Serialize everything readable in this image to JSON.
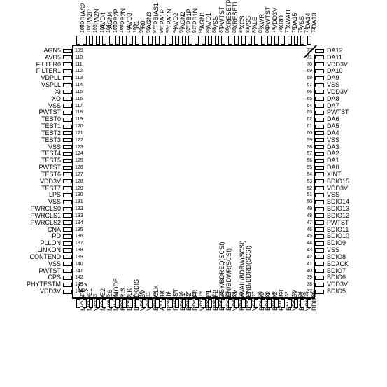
{
  "diagram": {
    "type": "ic-pinout",
    "package": "144-pin QFP",
    "pin_count": 144,
    "pin1_marker": "circle-top-left"
  },
  "pins": {
    "left": [
      {
        "num": "109",
        "label": "AGN5"
      },
      {
        "num": "110",
        "label": "AVD5"
      },
      {
        "num": "111",
        "label": "FILTER0"
      },
      {
        "num": "112",
        "label": "FILTER1"
      },
      {
        "num": "113",
        "label": "VDPLL"
      },
      {
        "num": "114",
        "label": "VSPLL"
      },
      {
        "num": "115",
        "label": "XI"
      },
      {
        "num": "116",
        "label": "XO"
      },
      {
        "num": "117",
        "label": "VSS"
      },
      {
        "num": "118",
        "label": "PWTST"
      },
      {
        "num": "119",
        "label": "TEST0"
      },
      {
        "num": "120",
        "label": "TEST1"
      },
      {
        "num": "121",
        "label": "TEST2"
      },
      {
        "num": "122",
        "label": "TEST3"
      },
      {
        "num": "123",
        "label": "VSS"
      },
      {
        "num": "124",
        "label": "TEST4"
      },
      {
        "num": "125",
        "label": "TEST5"
      },
      {
        "num": "126",
        "label": "PWTST"
      },
      {
        "num": "127",
        "label": "TEST6"
      },
      {
        "num": "128",
        "label": "VDD3V"
      },
      {
        "num": "129",
        "label": "TEST7"
      },
      {
        "num": "130",
        "label": "LPS"
      },
      {
        "num": "131",
        "label": "VSS"
      },
      {
        "num": "132",
        "label": "PWRCLS0"
      },
      {
        "num": "133",
        "label": "PWRCLS1"
      },
      {
        "num": "134",
        "label": "PWRCLS2"
      },
      {
        "num": "135",
        "label": "CNA"
      },
      {
        "num": "136",
        "label": "PD"
      },
      {
        "num": "137",
        "label": "PLLON"
      },
      {
        "num": "138",
        "label": "LINKON"
      },
      {
        "num": "139",
        "label": "CONTEND"
      },
      {
        "num": "140",
        "label": "VSS"
      },
      {
        "num": "141",
        "label": "PWTST"
      },
      {
        "num": "142",
        "label": "CPS"
      },
      {
        "num": "143",
        "label": "PHYTESTM"
      },
      {
        "num": "144",
        "label": "VDD3V"
      }
    ],
    "right": [
      {
        "num": "72",
        "label": "DA12"
      },
      {
        "num": "71",
        "label": "DA11"
      },
      {
        "num": "70",
        "label": "VDD3V"
      },
      {
        "num": "69",
        "label": "DA10"
      },
      {
        "num": "68",
        "label": "DA9"
      },
      {
        "num": "67",
        "label": "VSS"
      },
      {
        "num": "66",
        "label": "VDD3V"
      },
      {
        "num": "65",
        "label": "DA8"
      },
      {
        "num": "64",
        "label": "DA7"
      },
      {
        "num": "63",
        "label": "PWTST"
      },
      {
        "num": "62",
        "label": "DA6"
      },
      {
        "num": "61",
        "label": "DA5"
      },
      {
        "num": "60",
        "label": "DA4"
      },
      {
        "num": "59",
        "label": "VSS"
      },
      {
        "num": "58",
        "label": "DA3"
      },
      {
        "num": "57",
        "label": "DA2"
      },
      {
        "num": "56",
        "label": "DA1"
      },
      {
        "num": "55",
        "label": "DA0"
      },
      {
        "num": "54",
        "label": "XINT"
      },
      {
        "num": "53",
        "label": "BDIO15"
      },
      {
        "num": "52",
        "label": "VDD3V"
      },
      {
        "num": "51",
        "label": "VSS"
      },
      {
        "num": "50",
        "label": "BDIO14"
      },
      {
        "num": "49",
        "label": "BDIO13"
      },
      {
        "num": "48",
        "label": "BDIO12"
      },
      {
        "num": "47",
        "label": "PWTST"
      },
      {
        "num": "46",
        "label": "BDIO11"
      },
      {
        "num": "45",
        "label": "BDIO10"
      },
      {
        "num": "44",
        "label": "BDIO9"
      },
      {
        "num": "43",
        "label": "VSS"
      },
      {
        "num": "42",
        "label": "BDIO8"
      },
      {
        "num": "41",
        "label": "BDACK"
      },
      {
        "num": "40",
        "label": "BDIO7"
      },
      {
        "num": "39",
        "label": "BDIO6"
      },
      {
        "num": "38",
        "label": "VDD3V"
      },
      {
        "num": "37",
        "label": "BDIO5"
      }
    ],
    "top": [
      {
        "num": "108",
        "label": "TPBIAS2"
      },
      {
        "num": "107",
        "label": "TPA2P"
      },
      {
        "num": "106",
        "label": "TPA2N"
      },
      {
        "num": "105",
        "label": "AVD4"
      },
      {
        "num": "104",
        "label": "AGN4"
      },
      {
        "num": "103",
        "label": "TPB2P"
      },
      {
        "num": "102",
        "label": "TPB2N"
      },
      {
        "num": "101",
        "label": "AVD3"
      },
      {
        "num": "100",
        "label": "R1"
      },
      {
        "num": "99",
        "label": "R0"
      },
      {
        "num": "98",
        "label": "AGN3"
      },
      {
        "num": "97",
        "label": "TPBIAS1"
      },
      {
        "num": "96",
        "label": "TPA1P"
      },
      {
        "num": "95",
        "label": "TPA1N"
      },
      {
        "num": "94",
        "label": "AVD2"
      },
      {
        "num": "93",
        "label": "AGN2"
      },
      {
        "num": "92",
        "label": "TPB1P"
      },
      {
        "num": "91",
        "label": "TPB1N"
      },
      {
        "num": "90",
        "label": "AGN1"
      },
      {
        "num": "89",
        "label": "AVD1"
      },
      {
        "num": "88",
        "label": "VSS"
      },
      {
        "num": "87",
        "label": "PWTST"
      },
      {
        "num": "86",
        "label": "XRESETP"
      },
      {
        "num": "85",
        "label": "XRESETL"
      },
      {
        "num": "84",
        "label": "XCS"
      },
      {
        "num": "83",
        "label": "VSS"
      },
      {
        "num": "82",
        "label": "ALE"
      },
      {
        "num": "81",
        "label": "XWR"
      },
      {
        "num": "80",
        "label": "PWTST"
      },
      {
        "num": "79",
        "label": "VDD3V"
      },
      {
        "num": "78",
        "label": "XRD"
      },
      {
        "num": "77",
        "label": "XWAIT"
      },
      {
        "num": "76",
        "label": "DA15"
      },
      {
        "num": "75",
        "label": "VSS"
      },
      {
        "num": "74",
        "label": "DA14"
      },
      {
        "num": "73",
        "label": "DA13"
      }
    ],
    "bottom": [
      {
        "num": "1",
        "label": "MODE0"
      },
      {
        "num": "2",
        "label": "MODE1"
      },
      {
        "num": "3",
        "label": "VSS"
      },
      {
        "num": "4",
        "label": "MODE2"
      },
      {
        "num": "5",
        "label": "M8M16"
      },
      {
        "num": "6",
        "label": "MUXMODE"
      },
      {
        "num": "7",
        "label": "BDTRIS"
      },
      {
        "num": "8",
        "label": "BDICLK"
      },
      {
        "num": "9",
        "label": "BDCLKDIS"
      },
      {
        "num": "10",
        "label": "VDD3V"
      },
      {
        "num": "11",
        "label": "VSS"
      },
      {
        "num": "12",
        "label": "BDOCLK"
      },
      {
        "num": "13",
        "label": "ATAOX"
      },
      {
        "num": "14",
        "label": "BDIF0"
      },
      {
        "num": "15",
        "label": "PWTST"
      },
      {
        "num": "16",
        "label": "BDIF1"
      },
      {
        "num": "17",
        "label": "BDIF2"
      },
      {
        "num": "18",
        "label": "BDOF0"
      },
      {
        "num": "19",
        "label": "VSS"
      },
      {
        "num": "20",
        "label": "BDOF1"
      },
      {
        "num": "21",
        "label": "BDOF2"
      },
      {
        "num": "22",
        "label": "BDBUSY/BDREQ(SCSI)"
      },
      {
        "num": "23",
        "label": "BDOEN/BDWR(SCSI)"
      },
      {
        "num": "24",
        "label": "VDD3V"
      },
      {
        "num": "25",
        "label": "BDOAVAIL/BDRW(SCSI)"
      },
      {
        "num": "26",
        "label": "BDOENB/BDRD(SCSI)"
      },
      {
        "num": "27",
        "label": "VSS"
      },
      {
        "num": "28",
        "label": "BDIO0"
      },
      {
        "num": "29",
        "label": "BDIO1"
      },
      {
        "num": "30",
        "label": "BDIO2"
      },
      {
        "num": "31",
        "label": "PWTST"
      },
      {
        "num": "32",
        "label": "EN",
        "overline": true
      },
      {
        "num": "33",
        "label": "VDD3V"
      },
      {
        "num": "34",
        "label": "BDIO3"
      },
      {
        "num": "35",
        "label": "VSS"
      },
      {
        "num": "36",
        "label": "BDIO4"
      }
    ]
  },
  "colors": {
    "outline": "#000000",
    "background": "#ffffff",
    "text": "#000000"
  }
}
